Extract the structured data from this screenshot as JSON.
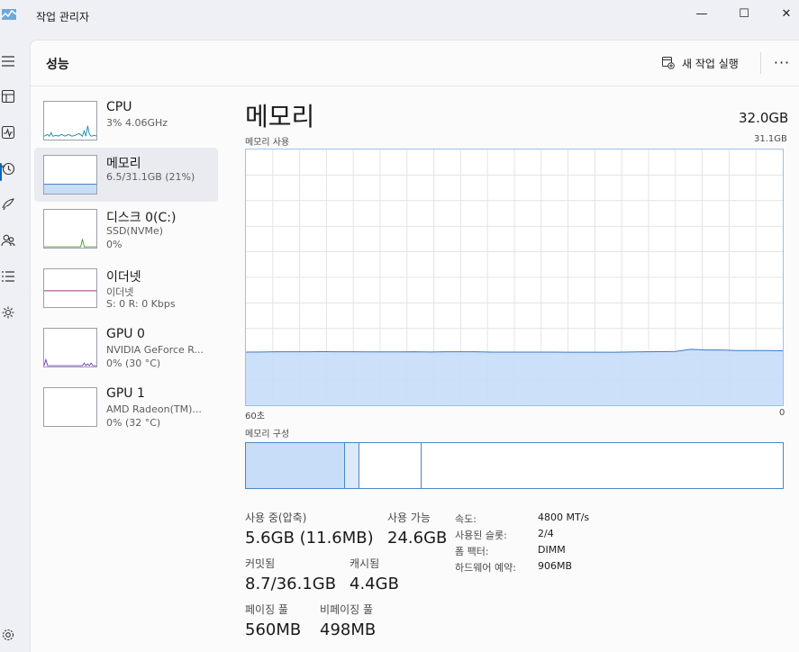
{
  "window": {
    "title": "작업 관리자",
    "min_glyph": "—",
    "max_glyph": "☐",
    "close_glyph": "✕"
  },
  "rail_icons": [
    "hamburger-icon",
    "processes-icon",
    "performance-icon",
    "app-history-icon",
    "startup-apps-icon",
    "users-icon",
    "details-icon",
    "services-icon",
    "settings-icon"
  ],
  "header": {
    "title": "성능",
    "run_task_label": "새 작업 실행",
    "more_label": "···"
  },
  "devices": [
    {
      "name": "CPU",
      "sub1": "3% 4.06GHz",
      "sub2": "",
      "color": "#1f8fb0"
    },
    {
      "name": "메모리",
      "sub1": "6.5/31.1GB (21%)",
      "sub2": "",
      "color": "#4a7fc1"
    },
    {
      "name": "디스크 0(C:)",
      "sub1": "SSD(NVMe)",
      "sub2": "0%",
      "color": "#4ca02a"
    },
    {
      "name": "이더넷",
      "sub1": "이더넷",
      "sub2": "S: 0  R: 0 Kbps",
      "color": "#a83284"
    },
    {
      "name": "GPU 0",
      "sub1": "NVIDIA GeForce R...",
      "sub2": "0%  (30 °C)",
      "color": "#7a3fc6"
    },
    {
      "name": "GPU 1",
      "sub1": "AMD Radeon(TM)...",
      "sub2": "0%  (32 °C)",
      "color": "#7a3fc6"
    }
  ],
  "detail": {
    "title": "메모리",
    "total": "32.0GB",
    "usage_label": "메모리 사용",
    "usage_max": "31.1GB",
    "time_left": "60초",
    "time_right": "0",
    "composition_label": "메모리 구성"
  },
  "stats": {
    "in_use_label": "사용 중(압축)",
    "in_use_value": "5.6GB (11.6MB)",
    "available_label": "사용 가능",
    "available_value": "24.6GB",
    "committed_label": "커밋됨",
    "committed_value": "8.7/36.1GB",
    "cached_label": "캐시됨",
    "cached_value": "4.4GB",
    "paged_label": "페이징 풀",
    "paged_value": "560MB",
    "nonpaged_label": "비페이징 풀",
    "nonpaged_value": "498MB"
  },
  "properties": [
    {
      "label": "속도:",
      "value": "4800 MT/s"
    },
    {
      "label": "사용된 슬롯:",
      "value": "2/4"
    },
    {
      "label": "폼 팩터:",
      "value": "DIMM"
    },
    {
      "label": "하드웨어 예약:",
      "value": "906MB"
    }
  ],
  "chart_data": {
    "type": "area",
    "title": "메모리 사용",
    "ylim": [
      0,
      31.1
    ],
    "y_unit": "GB",
    "x_range_seconds": [
      60,
      0
    ],
    "series": [
      {
        "values": [
          6.46,
          6.47,
          6.5,
          6.5,
          6.5,
          6.52,
          6.5,
          6.5,
          6.48,
          6.48,
          6.48,
          6.5,
          6.47,
          6.5,
          6.5,
          6.5,
          6.46,
          6.46,
          6.46,
          6.46,
          6.46,
          6.45,
          6.45,
          6.45,
          6.45,
          6.47,
          6.5,
          6.52,
          6.55,
          6.8,
          6.72,
          6.72,
          6.66,
          6.66,
          6.66,
          6.63
        ]
      }
    ],
    "grid": true,
    "colors": {
      "fill": "#c7ddf8",
      "line": "#3d78c4",
      "grid": "#e1e4e8"
    }
  }
}
